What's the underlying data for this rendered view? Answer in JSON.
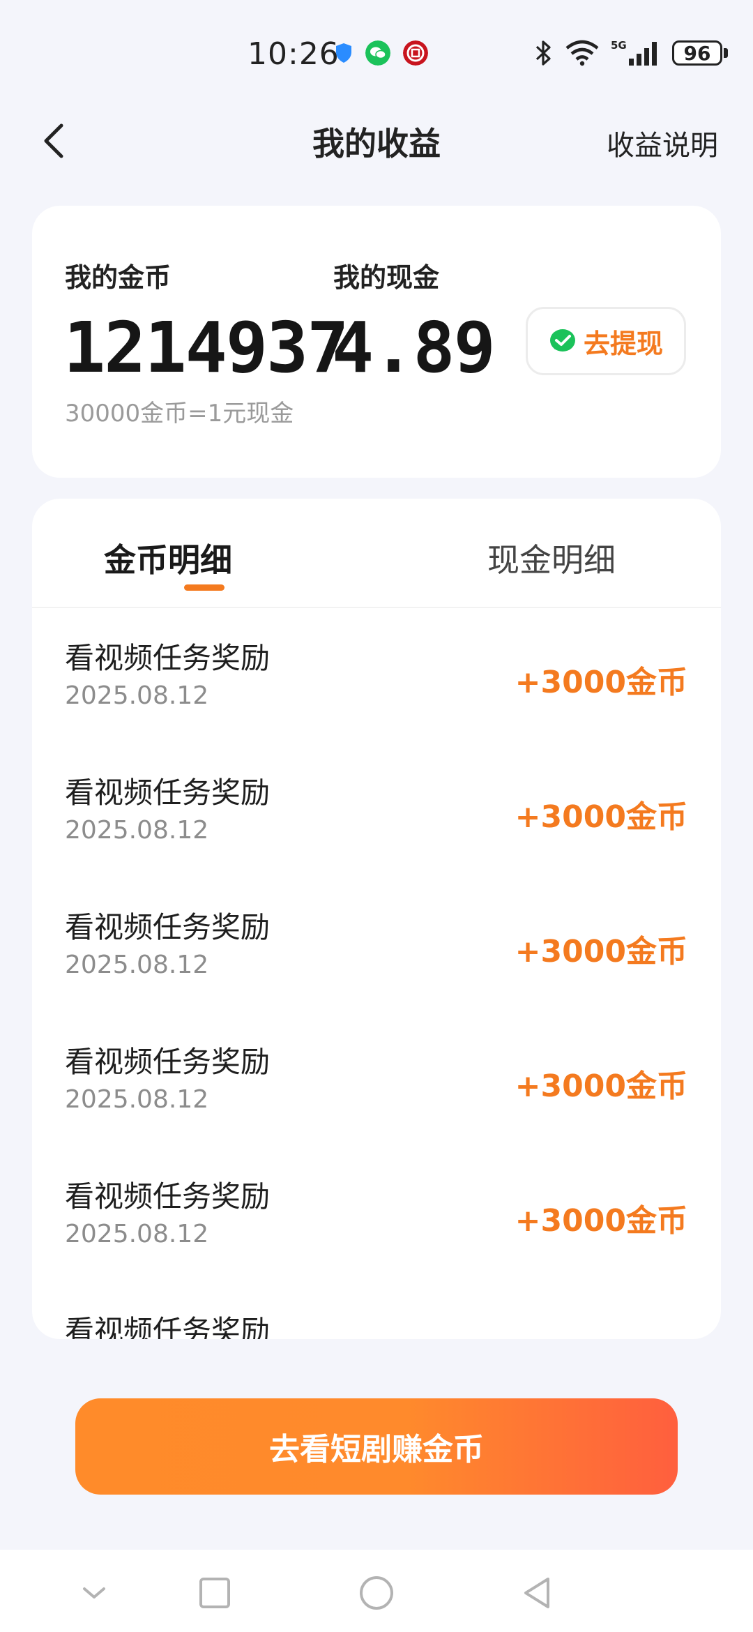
{
  "status_bar": {
    "time": "10:26",
    "battery": "96",
    "network": "5G",
    "icons": [
      "shield-icon",
      "wechat-icon",
      "bank-icon",
      "bluetooth-icon",
      "wifi-icon",
      "signal-icon",
      "battery-icon"
    ]
  },
  "header": {
    "title": "我的收益",
    "explain_link": "收益说明"
  },
  "summary": {
    "coins_label": "我的金币",
    "coins_value": "1214937",
    "cash_label": "我的现金",
    "cash_value": "4.89",
    "rate_text": "30000金币=1元现金",
    "withdraw_label": "去提现"
  },
  "tabs": [
    {
      "label": "金币明细",
      "active": true
    },
    {
      "label": "现金明细",
      "active": false
    }
  ],
  "records": [
    {
      "title": "看视频任务奖励",
      "date": "2025.08.12",
      "amount": "+3000金币"
    },
    {
      "title": "看视频任务奖励",
      "date": "2025.08.12",
      "amount": "+3000金币"
    },
    {
      "title": "看视频任务奖励",
      "date": "2025.08.12",
      "amount": "+3000金币"
    },
    {
      "title": "看视频任务奖励",
      "date": "2025.08.12",
      "amount": "+3000金币"
    },
    {
      "title": "看视频任务奖励",
      "date": "2025.08.12",
      "amount": "+3000金币"
    },
    {
      "title": "看视频任务奖励",
      "date": "",
      "amount": ""
    }
  ],
  "cta_label": "去看短剧赚金币",
  "colors": {
    "accent": "#f47a1f",
    "background": "#f4f5fb",
    "cta_start": "#ff8b2a",
    "cta_end": "#ff5f3e",
    "wechat_green": "#1bc25a"
  }
}
